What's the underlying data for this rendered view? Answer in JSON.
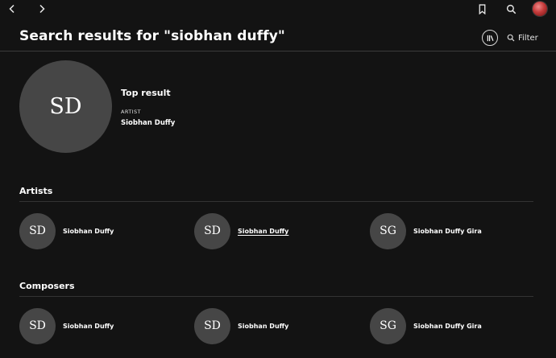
{
  "header": {
    "title": "Search results for \"siobhan duffy\"",
    "filter_label": "Filter"
  },
  "icons": {
    "back": "chevron-left-icon",
    "forward": "chevron-right-icon",
    "bookmark": "bookmark-icon",
    "search": "search-icon",
    "library": "library-icon",
    "filter": "search-icon"
  },
  "top_result": {
    "label": "Top result",
    "initials": "SD",
    "type": "ARTIST",
    "name": "Siobhan Duffy"
  },
  "artists": {
    "title": "Artists",
    "items": [
      {
        "initials": "SD",
        "name": "Siobhan Duffy"
      },
      {
        "initials": "SD",
        "name": "Siobhan Duffy",
        "underlined": true
      },
      {
        "initials": "SG",
        "name": "Siobhan Duffy Gira"
      }
    ]
  },
  "composers": {
    "title": "Composers",
    "items": [
      {
        "initials": "SD",
        "name": "Siobhan Duffy"
      },
      {
        "initials": "SD",
        "name": "Siobhan Duffy"
      },
      {
        "initials": "SG",
        "name": "Siobhan Duffy Gira"
      }
    ]
  },
  "colors": {
    "background": "#131313",
    "placeholder": "#464646",
    "divider": "#3b3b3b"
  }
}
